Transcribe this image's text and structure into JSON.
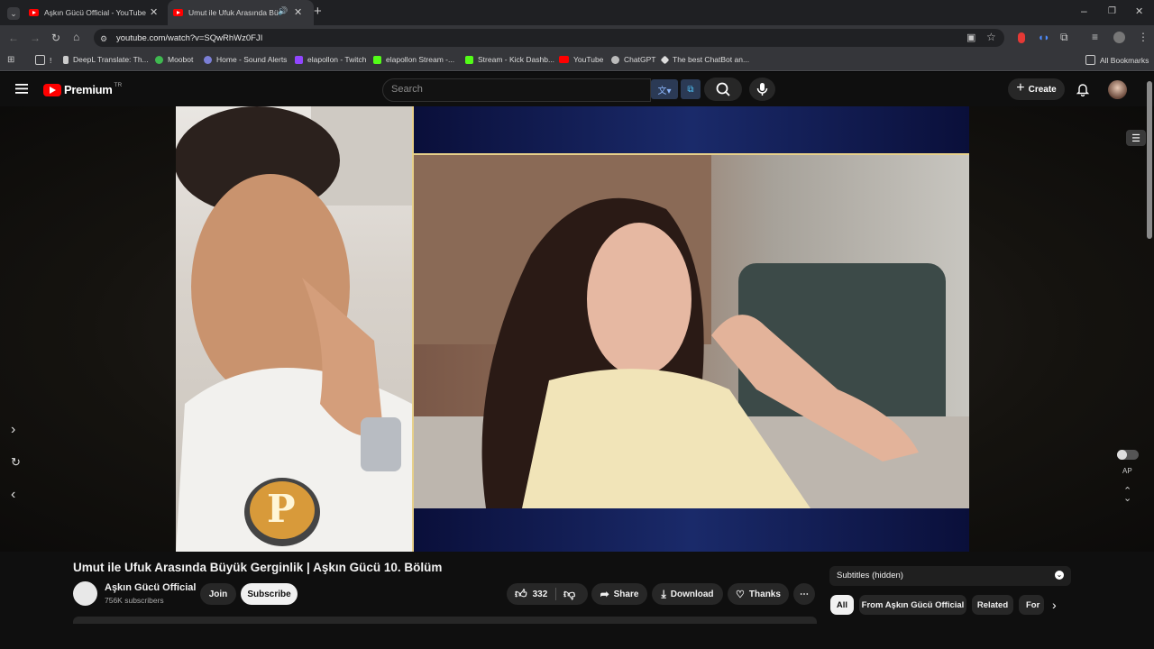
{
  "browser": {
    "tabs": [
      {
        "title": "Aşkın Gücü Official - YouTube",
        "active": false
      },
      {
        "title": "Umut ile Ufuk Arasında Büy",
        "active": true
      }
    ],
    "url": "youtube.com/watch?v=SQwRhWz0FJI",
    "bookmarks": [
      {
        "label": "!",
        "icon": "folder-icon"
      },
      {
        "label": "DeepL Translate: Th...",
        "icon": "deepl-icon"
      },
      {
        "label": "Moobot",
        "icon": "moobot-icon"
      },
      {
        "label": "Home - Sound Alerts",
        "icon": "soundalerts-icon"
      },
      {
        "label": "elapollon - Twitch",
        "icon": "twitch-icon"
      },
      {
        "label": "elapollon Stream -...",
        "icon": "kick-icon"
      },
      {
        "label": "Stream - Kick Dashb...",
        "icon": "kick-icon"
      },
      {
        "label": "YouTube",
        "icon": "youtube-icon"
      },
      {
        "label": "ChatGPT",
        "icon": "chatgpt-icon"
      },
      {
        "label": "The best ChatBot an...",
        "icon": "chatbot-icon"
      }
    ],
    "all_bookmarks": "All Bookmarks"
  },
  "youtube": {
    "logo_text": "Premium",
    "region": "TR",
    "search_placeholder": "Search",
    "create_label": "Create",
    "video_title": "Umut ile Ufuk Arasında Büyük Gerginlik | Aşkın Gücü 10. Bölüm",
    "channel_name": "Aşkın Gücü Official",
    "subscribers": "756K subscribers",
    "join_label": "Join",
    "subscribe_label": "Subscribe",
    "like_count": "332",
    "share_label": "Share",
    "download_label": "Download",
    "thanks_label": "Thanks",
    "subtitles_label": "Subtitles (hidden)",
    "chips": [
      "All",
      "From Aşkın Gücü Official",
      "Related",
      "For"
    ],
    "autoplay_label": "AP",
    "badge_letter": "P"
  },
  "colors": {
    "youtube_red": "#ff0000",
    "bg": "#0f0f0f",
    "chrome_bg": "#35363a",
    "gold_border": "#e7d08a"
  }
}
